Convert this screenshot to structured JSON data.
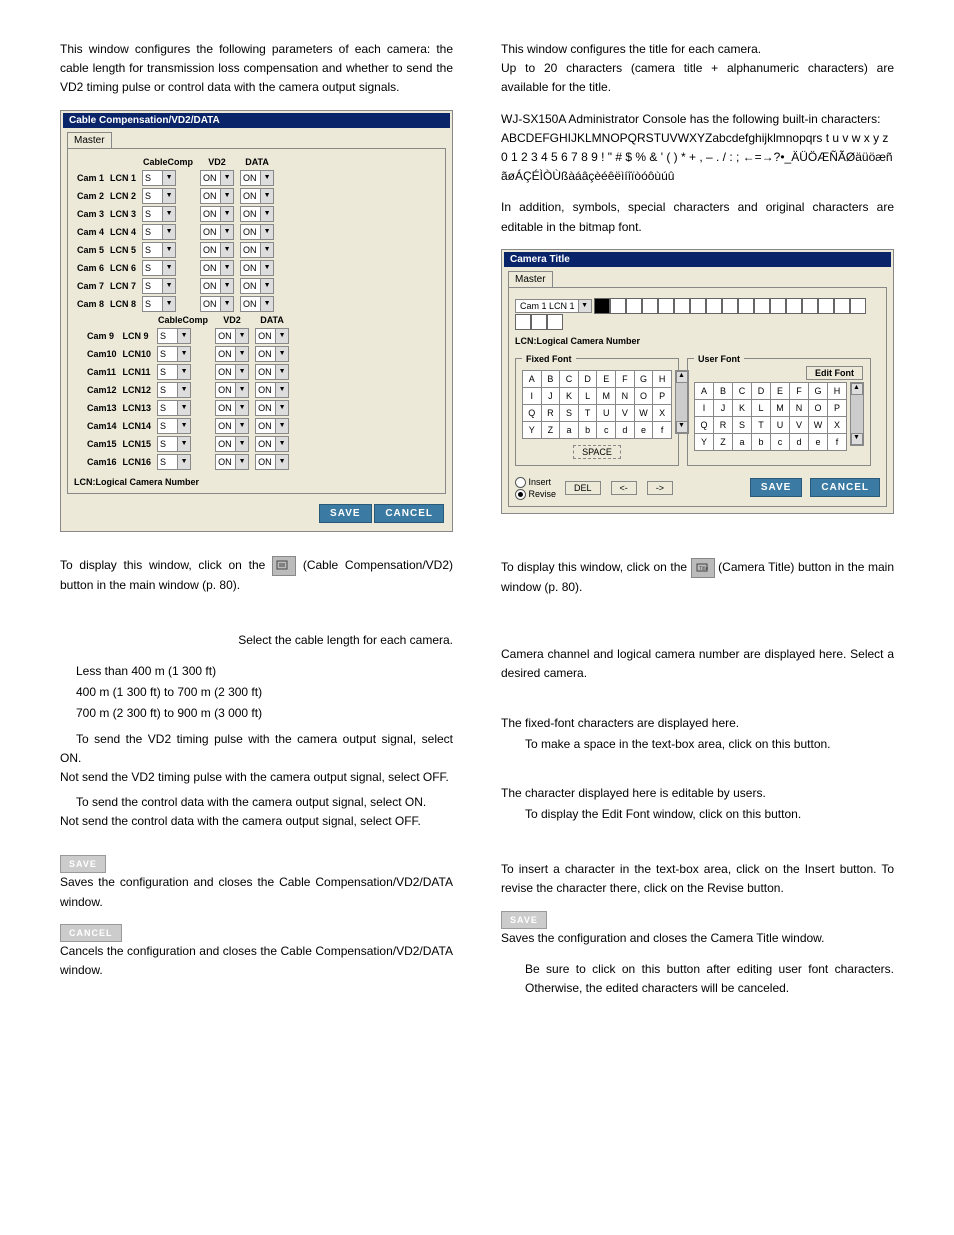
{
  "left": {
    "intro": "This window configures the following parameters of each camera: the cable length for transmission loss compensation and whether to send the VD2 timing pulse or control data with the camera output signals.",
    "panel": {
      "title": "Cable Compensation/VD2/DATA",
      "tab": "Master",
      "headers": {
        "cablecomp": "CableComp",
        "vd2": "VD2",
        "data": "DATA"
      },
      "rows_left": [
        {
          "cam": "Cam 1",
          "lcn": "LCN 1",
          "cc": "S",
          "vd2": "ON",
          "data": "ON"
        },
        {
          "cam": "Cam 2",
          "lcn": "LCN 2",
          "cc": "S",
          "vd2": "ON",
          "data": "ON"
        },
        {
          "cam": "Cam 3",
          "lcn": "LCN 3",
          "cc": "S",
          "vd2": "ON",
          "data": "ON"
        },
        {
          "cam": "Cam 4",
          "lcn": "LCN 4",
          "cc": "S",
          "vd2": "ON",
          "data": "ON"
        },
        {
          "cam": "Cam 5",
          "lcn": "LCN 5",
          "cc": "S",
          "vd2": "ON",
          "data": "ON"
        },
        {
          "cam": "Cam 6",
          "lcn": "LCN 6",
          "cc": "S",
          "vd2": "ON",
          "data": "ON"
        },
        {
          "cam": "Cam 7",
          "lcn": "LCN 7",
          "cc": "S",
          "vd2": "ON",
          "data": "ON"
        },
        {
          "cam": "Cam 8",
          "lcn": "LCN 8",
          "cc": "S",
          "vd2": "ON",
          "data": "ON"
        }
      ],
      "rows_right": [
        {
          "cam": "Cam 9",
          "lcn": "LCN 9",
          "cc": "S",
          "vd2": "ON",
          "data": "ON"
        },
        {
          "cam": "Cam10",
          "lcn": "LCN10",
          "cc": "S",
          "vd2": "ON",
          "data": "ON"
        },
        {
          "cam": "Cam11",
          "lcn": "LCN11",
          "cc": "S",
          "vd2": "ON",
          "data": "ON"
        },
        {
          "cam": "Cam12",
          "lcn": "LCN12",
          "cc": "S",
          "vd2": "ON",
          "data": "ON"
        },
        {
          "cam": "Cam13",
          "lcn": "LCN13",
          "cc": "S",
          "vd2": "ON",
          "data": "ON"
        },
        {
          "cam": "Cam14",
          "lcn": "LCN14",
          "cc": "S",
          "vd2": "ON",
          "data": "ON"
        },
        {
          "cam": "Cam15",
          "lcn": "LCN15",
          "cc": "S",
          "vd2": "ON",
          "data": "ON"
        },
        {
          "cam": "Cam16",
          "lcn": "LCN16",
          "cc": "S",
          "vd2": "ON",
          "data": "ON"
        }
      ],
      "lcn_note": "LCN:Logical Camera Number",
      "save": "SAVE",
      "cancel": "CANCEL"
    },
    "display_pre": "To display this window, click on the ",
    "display_post": " (Cable Compensation/VD2) button in the main window (p. 80).",
    "cablecomp_intro": "Select the cable length for each camera.",
    "cc_s": "Less than 400 m (1 300 ft)",
    "cc_m": "400 m (1 300 ft) to 700 m (2 300 ft)",
    "cc_l": "700 m (2 300 ft) to 900 m (3 000 ft)",
    "vd2_on": "To send the VD2 timing pulse with the camera output signal, select ON.",
    "vd2_off": "Not send the VD2 timing pulse with the camera output signal, select OFF.",
    "data_on": "To send the control data with the camera output signal, select ON.",
    "data_off": "Not send the control data with the camera output signal, select OFF.",
    "save_desc": "Saves the configuration and closes the Cable Compensation/VD2/DATA window.",
    "cancel_desc": "Cancels the configuration and closes the Cable Compensation/VD2/DATA window."
  },
  "right": {
    "intro1": "This window configures the title for each camera.",
    "intro2": "Up to 20 characters (camera title + alphanumeric characters) are available for the title.",
    "builtin1": "WJ-SX150A Administrator Console has the following built-in characters:",
    "builtin2": "ABCDEFGHIJKLMNOPQRSTUVWXYZabcdefghijklmnopqrs t u v w x y z 0 1 2 3 4 5 6 7 8 9 ! \" # $ % & ' ( ) * + , – . / : ; ←=→?•_ÄÜÖÆÑÃØäüöæñãøÁÇÉÌÒÙßàáâçèéêëìíîïòóôùúû",
    "addition": "In addition, symbols, special characters and original characters are editable in the bitmap font.",
    "panel": {
      "title": "Camera Title",
      "tab": "Master",
      "camsel": "Cam 1   LCN 1",
      "lcn_note": "LCN:Logical Camera Number",
      "fixed": "Fixed Font",
      "user": "User Font",
      "editfont": "Edit Font",
      "space": "SPACE",
      "insert": "Insert",
      "revise": "Revise",
      "del": "DEL",
      "left": "<-",
      "rightarr": "->",
      "save": "SAVE",
      "cancel": "CANCEL",
      "grid_fixed": [
        [
          "A",
          "B",
          "C",
          "D",
          "E",
          "F",
          "G",
          "H"
        ],
        [
          "I",
          "J",
          "K",
          "L",
          "M",
          "N",
          "O",
          "P"
        ],
        [
          "Q",
          "R",
          "S",
          "T",
          "U",
          "V",
          "W",
          "X"
        ],
        [
          "Y",
          "Z",
          "a",
          "b",
          "c",
          "d",
          "e",
          "f"
        ]
      ],
      "grid_user": [
        [
          "A",
          "B",
          "C",
          "D",
          "E",
          "F",
          "G",
          "H"
        ],
        [
          "I",
          "J",
          "K",
          "L",
          "M",
          "N",
          "O",
          "P"
        ],
        [
          "Q",
          "R",
          "S",
          "T",
          "U",
          "V",
          "W",
          "X"
        ],
        [
          "Y",
          "Z",
          "a",
          "b",
          "c",
          "d",
          "e",
          "f"
        ]
      ]
    },
    "display_pre": "To display this window, click on the ",
    "display_post": " (Camera Title) button in the main window (p. 80).",
    "camlcn": "Camera channel and logical camera number are displayed here. Select a desired camera.",
    "fixed_desc": "The fixed-font characters are displayed here.",
    "space_desc": "To make a space in the text-box area, click on this button.",
    "user_desc": "The character displayed here is editable by users.",
    "editfont_desc": "To display the Edit Font window, click on this button.",
    "insrev": "To insert a character in the text-box area, click on the Insert button. To revise the character there, click on the Revise button.",
    "save_desc": "Saves the configuration and closes the Camera Title window.",
    "note": "Be sure to click on this button after editing user font characters. Otherwise, the edited characters will be canceled."
  }
}
